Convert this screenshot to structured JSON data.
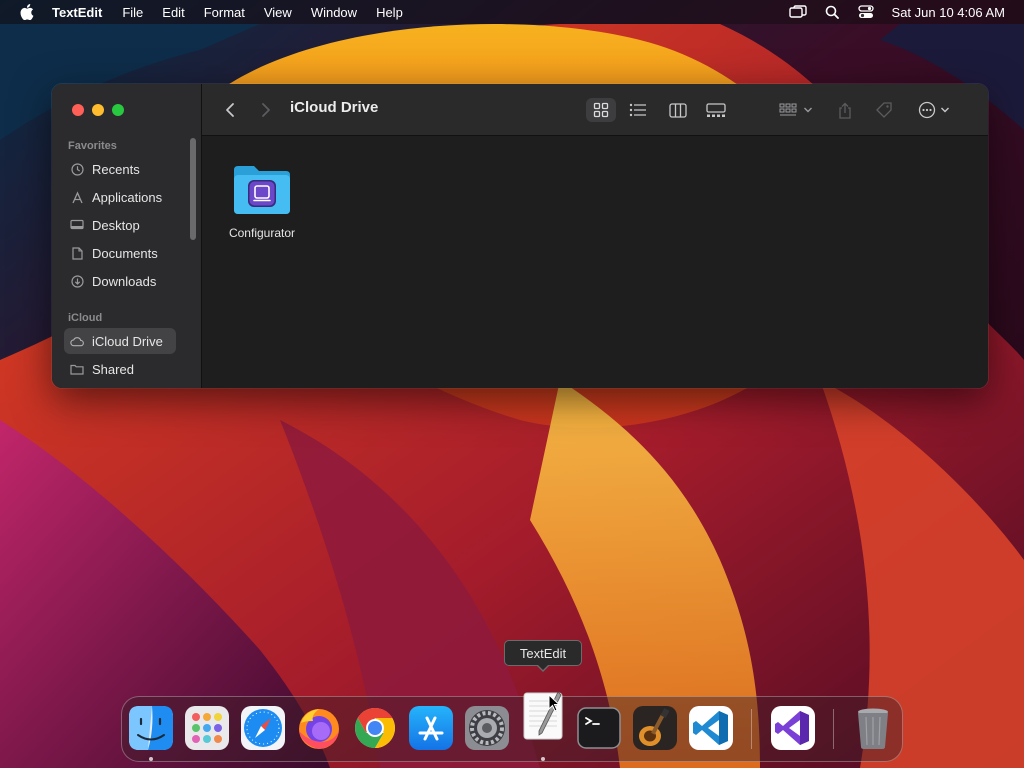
{
  "menubar": {
    "app_name": "TextEdit",
    "menus": [
      "File",
      "Edit",
      "Format",
      "View",
      "Window",
      "Help"
    ],
    "status_icons": [
      "screen-mirroring-icon",
      "spotlight-search-icon",
      "control-center-icon"
    ],
    "clock": "Sat Jun 10  4:06 AM"
  },
  "finder": {
    "title": "iCloud Drive",
    "sidebar": {
      "favorites_header": "Favorites",
      "favorites": [
        {
          "label": "Recents",
          "icon": "clock-icon"
        },
        {
          "label": "Applications",
          "icon": "applications-icon"
        },
        {
          "label": "Desktop",
          "icon": "desktop-icon"
        },
        {
          "label": "Documents",
          "icon": "document-icon"
        },
        {
          "label": "Downloads",
          "icon": "download-icon"
        }
      ],
      "icloud_header": "iCloud",
      "icloud": [
        {
          "label": "iCloud Drive",
          "icon": "cloud-icon",
          "selected": true
        },
        {
          "label": "Shared",
          "icon": "shared-folder-icon"
        }
      ]
    },
    "toolbar": {
      "view_modes": [
        "icon-view",
        "list-view",
        "column-view",
        "gallery-view"
      ],
      "selected_view": "icon-view"
    },
    "files": [
      {
        "name": "Configurator",
        "icon": "folder-icon",
        "color": "#3fb8f0"
      }
    ]
  },
  "tooltip": "TextEdit",
  "dock": {
    "apps": [
      "Finder",
      "Launchpad",
      "Safari",
      "Firefox",
      "Google Chrome",
      "App Store",
      "System Settings",
      "TextEdit",
      "Terminal",
      "GarageBand",
      "Visual Studio Code",
      "Visual Studio",
      "Trash"
    ],
    "running": [
      "Finder",
      "TextEdit"
    ]
  },
  "colors": {
    "window_bg": "#1e1e1e",
    "sidebar_bg": "#2b2a2c",
    "close": "#fe5f57",
    "minimize": "#febc2e",
    "maximize": "#28c840"
  }
}
